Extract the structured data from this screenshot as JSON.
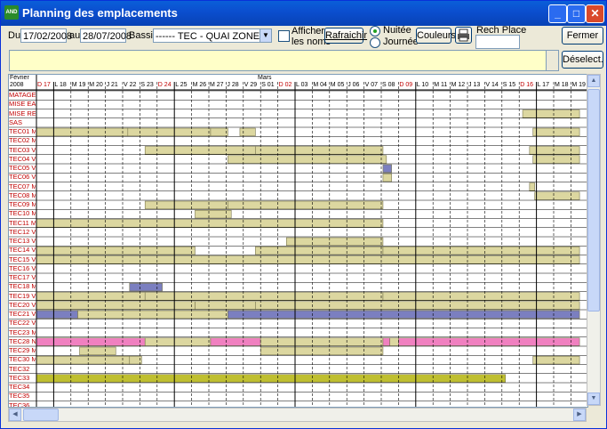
{
  "window": {
    "title": "Planning des emplacements",
    "app_icon": "AND"
  },
  "toolbar": {
    "du_label": "Du",
    "du_value": "17/02/2008",
    "au_label": "au",
    "au_value": "28/07/2008",
    "bassin_label": "Bassin",
    "bassin_value": "------ TEC  - QUAI ZONE TECHI",
    "afficher_label_1": "Afficher",
    "afficher_label_2": "les noms",
    "rafraichir": "Rafraichir",
    "nuitee": "Nuitée",
    "journee": "Journée",
    "couleurs": "Couleurs",
    "rech_place": "Rech Place",
    "fermer": "Fermer",
    "deselect": "Déselect."
  },
  "header": {
    "month1": "Février",
    "year": "2008",
    "month2": "Mars",
    "days": [
      {
        "t": "D 17",
        "red": true
      },
      {
        "t": "L 18"
      },
      {
        "t": "M 19"
      },
      {
        "t": "M 20"
      },
      {
        "t": "J 21"
      },
      {
        "t": "V 22"
      },
      {
        "t": "S 23"
      },
      {
        "t": "D 24",
        "red": true
      },
      {
        "t": "L 25"
      },
      {
        "t": "M 26"
      },
      {
        "t": "M 27"
      },
      {
        "t": "J 28"
      },
      {
        "t": "V 29"
      },
      {
        "t": "S 01"
      },
      {
        "t": "D 02",
        "red": true
      },
      {
        "t": "L 03"
      },
      {
        "t": "M 04"
      },
      {
        "t": "M 05"
      },
      {
        "t": "J 06"
      },
      {
        "t": "V 07"
      },
      {
        "t": "S 08"
      },
      {
        "t": "D 09",
        "red": true
      },
      {
        "t": "L 10"
      },
      {
        "t": "M 11"
      },
      {
        "t": "M 12"
      },
      {
        "t": "J 13"
      },
      {
        "t": "V 14"
      },
      {
        "t": "S 15"
      },
      {
        "t": "D 16",
        "red": true
      },
      {
        "t": "L 17"
      },
      {
        "t": "M 18"
      },
      {
        "t": "M 19"
      }
    ]
  },
  "rows": [
    {
      "label": "MATAGE",
      "bars": []
    },
    {
      "label": "MISE EAU",
      "bars": []
    },
    {
      "label": "MISE REMOR",
      "bars": [
        {
          "s": 28.2,
          "e": 31.5,
          "c": "khaki"
        }
      ]
    },
    {
      "label": "SAS",
      "bars": []
    },
    {
      "label": "TEC01 M",
      "bars": [
        {
          "s": 0,
          "e": 5.3,
          "c": "khaki"
        },
        {
          "s": 5.3,
          "e": 10.1,
          "c": "khaki"
        },
        {
          "s": 10.1,
          "e": 11.1,
          "c": "khaki"
        },
        {
          "s": 11.8,
          "e": 12.7,
          "c": "khaki"
        },
        {
          "s": 28.8,
          "e": 31.5,
          "c": "khaki"
        }
      ]
    },
    {
      "label": "TEC02 M",
      "bars": []
    },
    {
      "label": "TEC03 V",
      "bars": [
        {
          "s": 6.3,
          "e": 12.7,
          "c": "khaki"
        },
        {
          "s": 12.7,
          "e": 20.1,
          "c": "khaki"
        },
        {
          "s": 28.6,
          "e": 31.5,
          "c": "khaki"
        }
      ]
    },
    {
      "label": "TEC04 V",
      "bars": [
        {
          "s": 11.1,
          "e": 20.3,
          "c": "khaki"
        },
        {
          "s": 28.8,
          "e": 31.5,
          "c": "khaki"
        }
      ]
    },
    {
      "label": "TEC05 V",
      "bars": [
        {
          "s": 20.1,
          "e": 20.6,
          "c": "blue"
        }
      ]
    },
    {
      "label": "TEC06 V",
      "bars": [
        {
          "s": 20.1,
          "e": 20.6,
          "c": "khaki"
        }
      ]
    },
    {
      "label": "TEC07 M",
      "bars": [
        {
          "s": 28.6,
          "e": 28.9,
          "c": "khaki"
        }
      ]
    },
    {
      "label": "TEC08 M",
      "bars": [
        {
          "s": 28.9,
          "e": 31.5,
          "c": "khaki"
        }
      ]
    },
    {
      "label": "TEC09 M",
      "bars": [
        {
          "s": 6.3,
          "e": 11.1,
          "c": "khaki"
        },
        {
          "s": 11.1,
          "e": 20.1,
          "c": "khaki"
        }
      ]
    },
    {
      "label": "TEC10 M",
      "bars": [
        {
          "s": 9.2,
          "e": 11.3,
          "c": "khaki"
        }
      ]
    },
    {
      "label": "TEC11 M",
      "bars": [
        {
          "s": 0,
          "e": 20.1,
          "c": "khaki"
        }
      ]
    },
    {
      "label": "TEC12 V",
      "bars": []
    },
    {
      "label": "TEC13 V",
      "bars": [
        {
          "s": 14.5,
          "e": 20.1,
          "c": "khaki"
        }
      ]
    },
    {
      "label": "TEC14 V",
      "bars": [
        {
          "s": 0,
          "e": 9.2,
          "c": "khaki"
        },
        {
          "s": 12.7,
          "e": 20.1,
          "c": "khaki"
        },
        {
          "s": 20.1,
          "e": 31.5,
          "c": "khaki"
        }
      ]
    },
    {
      "label": "TEC15 V",
      "bars": [
        {
          "s": 0,
          "e": 31.5,
          "c": "khaki"
        }
      ]
    },
    {
      "label": "TEC16 V",
      "bars": []
    },
    {
      "label": "TEC17 V",
      "bars": []
    },
    {
      "label": "TEC18 M",
      "bars": [
        {
          "s": 5.4,
          "e": 7.3,
          "c": "blue"
        }
      ]
    },
    {
      "label": "TEC19 V",
      "bars": [
        {
          "s": 0,
          "e": 6.3,
          "c": "khaki"
        },
        {
          "s": 6.3,
          "e": 20.1,
          "c": "khaki"
        },
        {
          "s": 20.1,
          "e": 31.5,
          "c": "khaki"
        }
      ]
    },
    {
      "label": "TEC20 V",
      "bars": [
        {
          "s": 0,
          "e": 9.2,
          "c": "khaki"
        },
        {
          "s": 9.2,
          "e": 12.7,
          "c": "khaki"
        },
        {
          "s": 12.7,
          "e": 31.5,
          "c": "khaki"
        }
      ]
    },
    {
      "label": "TEC21 V",
      "bars": [
        {
          "s": 0,
          "e": 2.4,
          "c": "blue"
        },
        {
          "s": 2.4,
          "e": 11.1,
          "c": "khaki"
        },
        {
          "s": 11.1,
          "e": 31.5,
          "c": "blue"
        }
      ]
    },
    {
      "label": "TEC22 V",
      "bars": []
    },
    {
      "label": "TEC23 M",
      "bars": []
    },
    {
      "label": "TEC28 N",
      "bars": [
        {
          "s": 0,
          "e": 6.3,
          "c": "pink"
        },
        {
          "s": 6.3,
          "e": 10.1,
          "c": "khaki"
        },
        {
          "s": 10.1,
          "e": 13,
          "c": "pink"
        },
        {
          "s": 13,
          "e": 20.1,
          "c": "khaki"
        },
        {
          "s": 20.1,
          "e": 20.5,
          "c": "pink"
        },
        {
          "s": 20.5,
          "e": 21,
          "c": "khaki"
        },
        {
          "s": 21,
          "e": 31.5,
          "c": "pink"
        }
      ]
    },
    {
      "label": "TEC29 M",
      "bars": [
        {
          "s": 2.5,
          "e": 4.6,
          "c": "khaki"
        },
        {
          "s": 13,
          "e": 20.1,
          "c": "khaki"
        }
      ]
    },
    {
      "label": "TEC30 M",
      "bars": [
        {
          "s": 0,
          "e": 5.4,
          "c": "khaki"
        },
        {
          "s": 5.4,
          "e": 6.1,
          "c": "khaki"
        },
        {
          "s": 28.8,
          "e": 31.5,
          "c": "khaki"
        }
      ]
    },
    {
      "label": "TEC32",
      "bars": []
    },
    {
      "label": "TEC33",
      "bars": [
        {
          "s": 0,
          "e": 27.2,
          "c": "olive"
        }
      ]
    },
    {
      "label": "TEC34",
      "bars": []
    },
    {
      "label": "TEC35",
      "bars": []
    },
    {
      "label": "TEC36",
      "bars": []
    }
  ],
  "colors": {
    "khaki": "#dcd7a0",
    "blue": "#7b7fc0",
    "pink": "#f080c0",
    "olive": "#bfbf30",
    "red": "#c00000",
    "weekend": "#c00000"
  }
}
